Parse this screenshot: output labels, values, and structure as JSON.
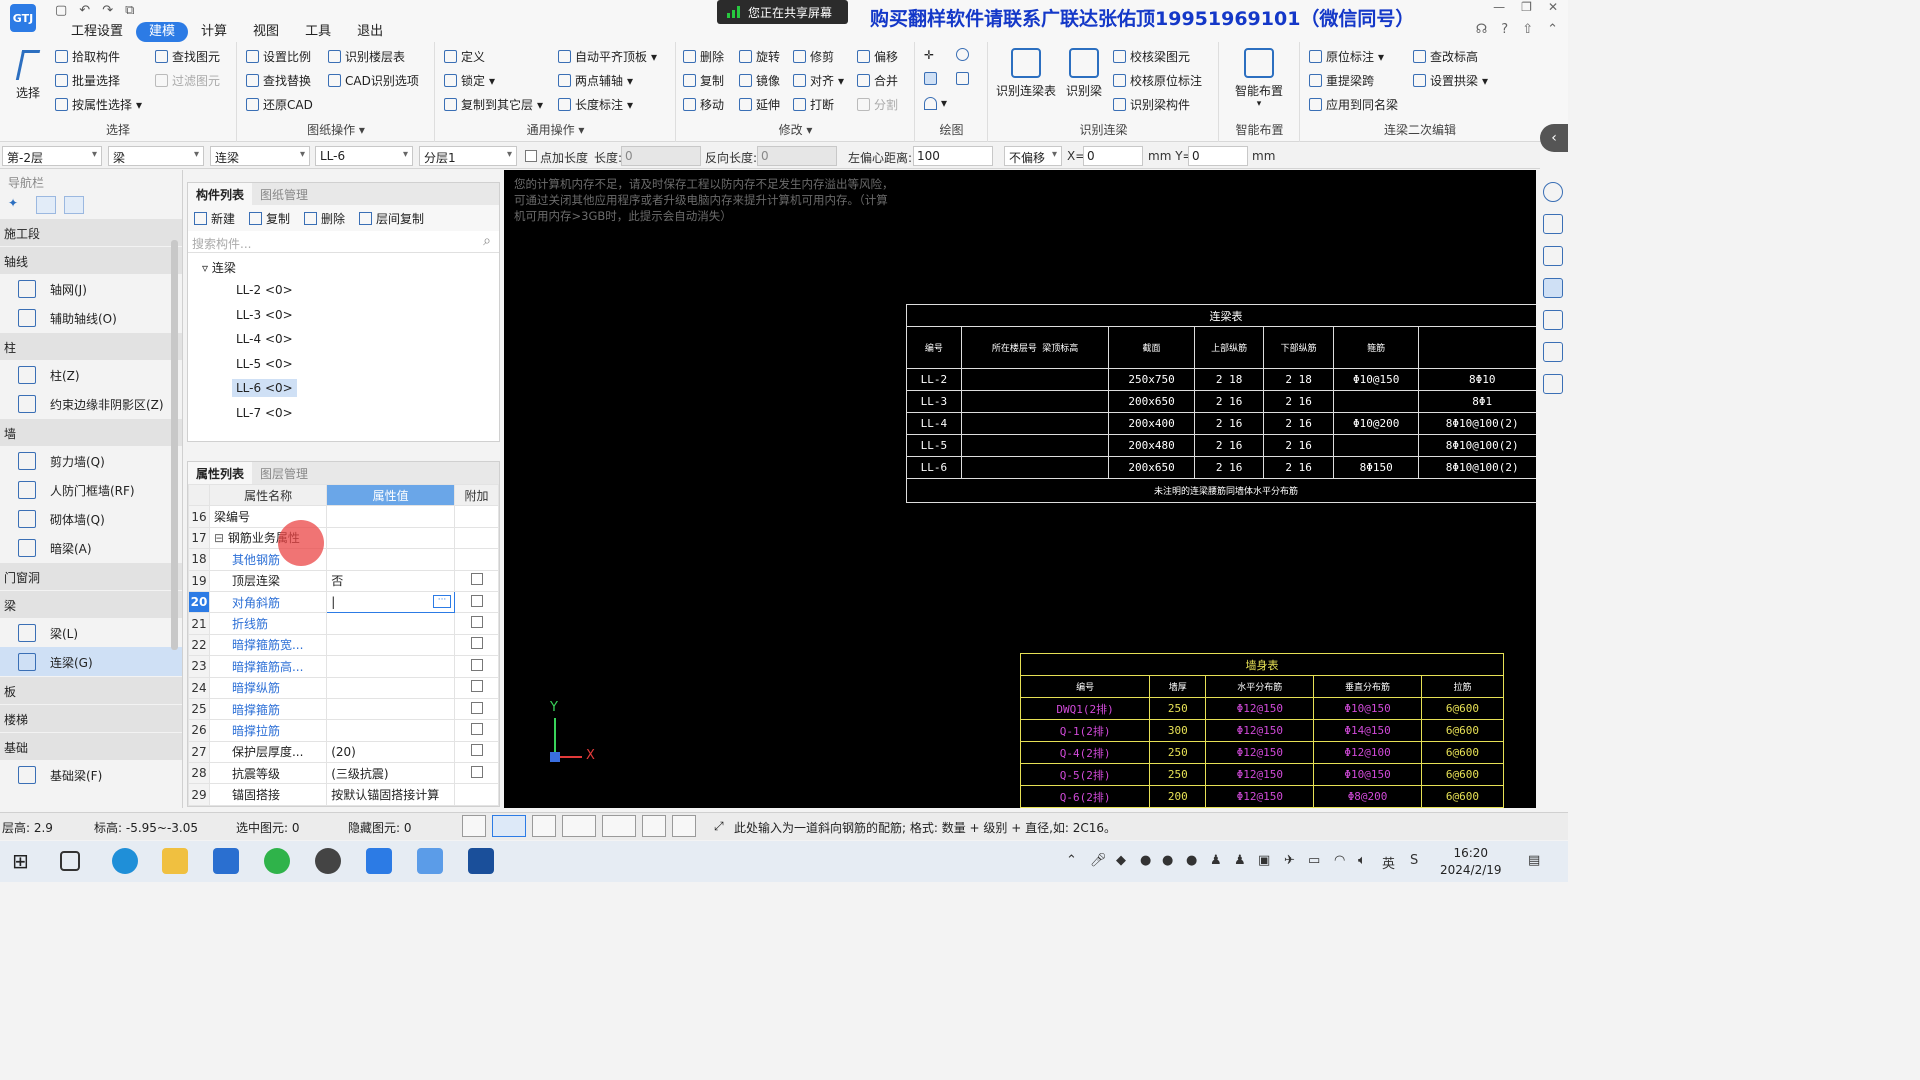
{
  "menu": [
    "工程设置",
    "建模",
    "计算",
    "视图",
    "工具",
    "退出"
  ],
  "menu_active": "建模",
  "share_banner": "您正在共享屏幕",
  "promo": "购买翻样软件请联系广联达张佑顶19951969101（微信同号）",
  "ribbon": {
    "select": {
      "label": "选择",
      "big": "选择",
      "items": [
        "拾取构件",
        "批量选择",
        "按属性选择",
        "查找图元",
        "过滤图元"
      ]
    },
    "drawing_ops": {
      "label": "图纸操作",
      "items": [
        "设置比例",
        "查找替换",
        "还原CAD",
        "识别楼层表",
        "CAD识别选项"
      ]
    },
    "common_ops": {
      "label": "通用操作",
      "items": [
        "定义",
        "锁定",
        "复制到其它层",
        "自动平齐顶板",
        "两点辅轴",
        "长度标注"
      ]
    },
    "modify": {
      "label": "修改",
      "items": [
        "删除",
        "旋转",
        "修剪",
        "偏移",
        "复制",
        "镜像",
        "对齐",
        "合并",
        "移动",
        "延伸",
        "打断",
        "分割"
      ]
    },
    "draw": {
      "label": "绘图"
    },
    "recognize": {
      "label": "识别连梁",
      "items": [
        "识别连梁表",
        "识别梁",
        "校核梁图元",
        "校核原位标注",
        "识别梁构件"
      ]
    },
    "smart": {
      "label": "智能布置",
      "items": [
        "智能布置"
      ]
    },
    "secondary": {
      "label": "连梁二次编辑",
      "items": [
        "原位标注",
        "重提梁跨",
        "应用到同名梁",
        "查改标高",
        "设置拱梁"
      ]
    }
  },
  "proprow": {
    "floor": "第-2层",
    "type": "梁",
    "subtype": "连梁",
    "comp": "LL-6",
    "layer": "分层1",
    "add_len_label": "点加长度",
    "len_label": "长度:",
    "len_val": "0",
    "rev_label": "反向长度:",
    "rev_val": "0",
    "offset_label": "左偏心距离:",
    "offset_val": "100",
    "shift": "不偏移",
    "x_label": "X=",
    "x_val": "0",
    "y_label": "mm Y=",
    "y_val": "0",
    "unit": "mm"
  },
  "nav": {
    "title": "导航栏",
    "sections": [
      {
        "cat": "施工段",
        "items": []
      },
      {
        "cat": "轴线",
        "items": [
          "轴网(J)",
          "辅助轴线(O)"
        ]
      },
      {
        "cat": "柱",
        "items": [
          "柱(Z)",
          "约束边缘非阴影区(Z)"
        ]
      },
      {
        "cat": "墙",
        "items": [
          "剪力墙(Q)",
          "人防门框墙(RF)",
          "砌体墙(Q)",
          "暗梁(A)"
        ]
      },
      {
        "cat": "门窗洞",
        "items": []
      },
      {
        "cat": "梁",
        "items": [
          "梁(L)",
          "连梁(G)"
        ]
      },
      {
        "cat": "板",
        "items": []
      },
      {
        "cat": "楼梯",
        "items": []
      },
      {
        "cat": "基础",
        "items": [
          "基础梁(F)"
        ]
      }
    ],
    "active": "连梁(G)"
  },
  "comp_panel": {
    "tabs": [
      "构件列表",
      "图纸管理"
    ],
    "toolbar": [
      "新建",
      "复制",
      "删除",
      "层间复制"
    ],
    "search_placeholder": "搜索构件...",
    "root": "连梁",
    "items": [
      "LL-2 <0>",
      "LL-3 <0>",
      "LL-4 <0>",
      "LL-5 <0>",
      "LL-6 <0>",
      "LL-7 <0>"
    ],
    "selected": "LL-6 <0>"
  },
  "prop_panel": {
    "tabs": [
      "属性列表",
      "图层管理"
    ],
    "headers": [
      "属性名称",
      "属性值",
      "附加"
    ],
    "rows": [
      {
        "n": "16",
        "name": "梁编号",
        "val": "",
        "chk": false,
        "style": ""
      },
      {
        "n": "17",
        "name": "钢筋业务属性",
        "val": "",
        "chk": false,
        "style": "group"
      },
      {
        "n": "18",
        "name": "其他钢筋",
        "val": "",
        "chk": false,
        "style": "blue"
      },
      {
        "n": "19",
        "name": "顶层连梁",
        "val": "否",
        "chk": true,
        "style": "ind"
      },
      {
        "n": "20",
        "name": "对角斜筋",
        "val": "",
        "chk": true,
        "style": "blue",
        "current": true
      },
      {
        "n": "21",
        "name": "折线筋",
        "val": "",
        "chk": true,
        "style": "blue"
      },
      {
        "n": "22",
        "name": "暗撑箍筋宽...",
        "val": "",
        "chk": true,
        "style": "blue"
      },
      {
        "n": "23",
        "name": "暗撑箍筋高...",
        "val": "",
        "chk": true,
        "style": "blue"
      },
      {
        "n": "24",
        "name": "暗撑纵筋",
        "val": "",
        "chk": true,
        "style": "blue"
      },
      {
        "n": "25",
        "name": "暗撑箍筋",
        "val": "",
        "chk": true,
        "style": "blue"
      },
      {
        "n": "26",
        "name": "暗撑拉筋",
        "val": "",
        "chk": true,
        "style": "blue"
      },
      {
        "n": "27",
        "name": "保护层厚度...",
        "val": "(20)",
        "chk": true,
        "style": "ind"
      },
      {
        "n": "28",
        "name": "抗震等级",
        "val": "(三级抗震)",
        "chk": true,
        "style": "ind"
      },
      {
        "n": "29",
        "name": "锚固搭接",
        "val": "按默认锚固搭接计算",
        "chk": false,
        "style": "ind"
      }
    ]
  },
  "canvas": {
    "warning": "您的计算机内存不足，请及时保存工程以防内存不足发生内存溢出等风险，可通过关闭其他应用程序或者升级电脑内存来提升计算机可用内存。（计算机可用内存>3GB时，此提示会自动消失）",
    "table1": {
      "title": "连梁表",
      "headers": [
        "编号",
        "所在楼层号 梁顶标高",
        "截面",
        "上部纵筋",
        "下部纵筋",
        "箍筋",
        ""
      ],
      "rows": [
        [
          "LL-2",
          "",
          "250x750",
          "2 18",
          "2 18",
          "Φ10@150",
          "8Φ10"
        ],
        [
          "LL-3",
          "",
          "200x650",
          "2 16",
          "2 16",
          "",
          "8Φ1"
        ],
        [
          "LL-4",
          "",
          "200x400",
          "2 16",
          "2 16",
          "Φ10@200",
          "8Φ10@100(2)"
        ],
        [
          "LL-5",
          "",
          "200x480",
          "2 16",
          "2 16",
          "",
          "8Φ10@100(2)"
        ],
        [
          "LL-6",
          "",
          "200x650",
          "2 16",
          "2 16",
          "8Φ150",
          "8Φ10@100(2)"
        ]
      ],
      "footer": "未注明的连梁腰筋同墙体水平分布筋"
    },
    "table2": {
      "title": "墙身表",
      "headers": [
        "编号",
        "墙厚",
        "水平分布筋",
        "垂直分布筋",
        "拉筋"
      ],
      "rows": [
        [
          "DWQ1(2排)",
          "250",
          "Φ12@150",
          "Φ10@150",
          "6@600"
        ],
        [
          "Q-1(2排)",
          "300",
          "Φ12@150",
          "Φ14@150",
          "6@600"
        ],
        [
          "Q-4(2排)",
          "250",
          "Φ12@150",
          "Φ12@100",
          "6@600"
        ],
        [
          "Q-5(2排)",
          "250",
          "Φ12@150",
          "Φ10@150",
          "6@600"
        ],
        [
          "Q-6(2排)",
          "200",
          "Φ12@150",
          "Φ8@200",
          "6@600"
        ]
      ]
    },
    "axis_y": "Y",
    "axis_x": "X"
  },
  "status": {
    "floor_h": "层高:  2.9",
    "elev": "标高:  -5.95~-3.05",
    "selected": "选中图元:  0",
    "hidden": "隐藏图元:  0",
    "hint": "此处输入为一道斜向钢筋的配筋; 格式: 数量 + 级别 + 直径,如: 2C16。"
  },
  "clock": {
    "time": "16:20",
    "date": "2024/2/19"
  }
}
